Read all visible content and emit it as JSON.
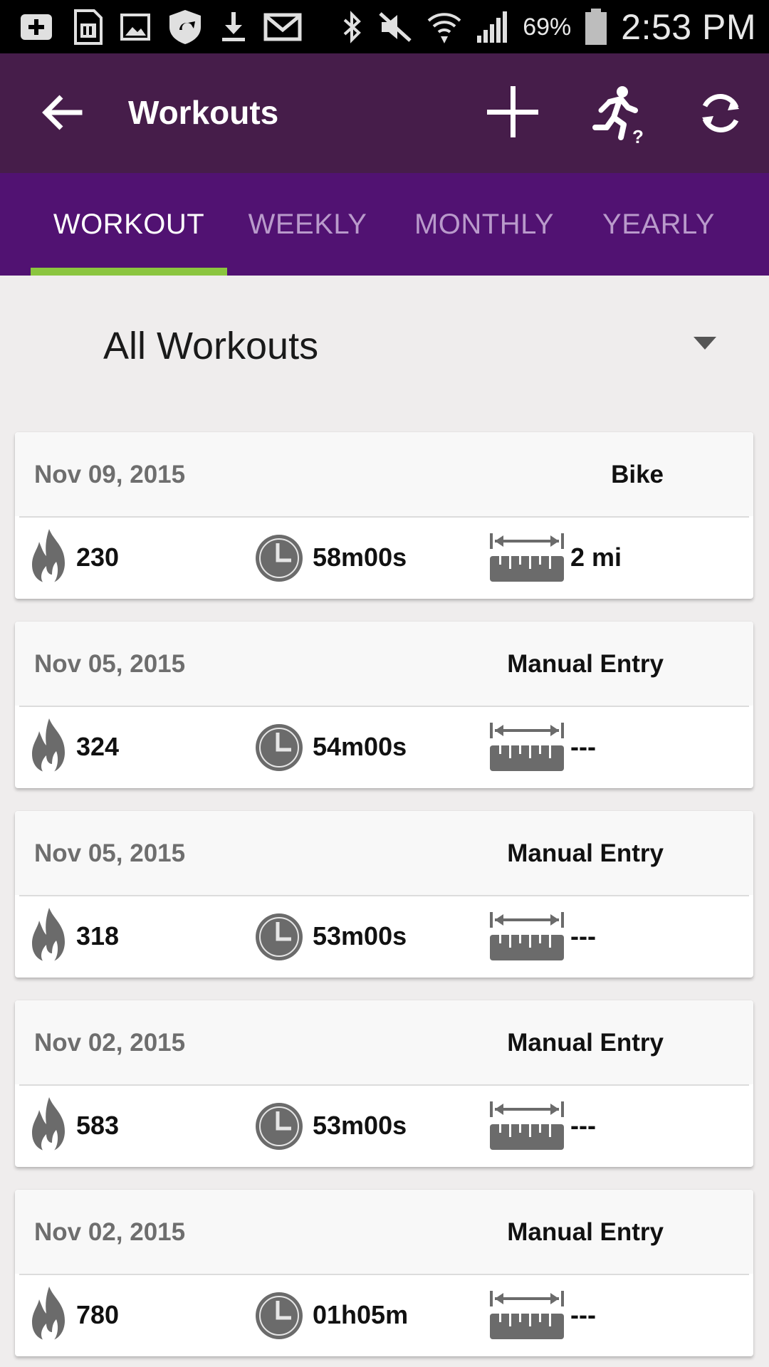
{
  "status_bar": {
    "icons": [
      "add-box-icon",
      "sim-card-icon",
      "image-icon",
      "shield-sync-icon",
      "download-icon",
      "gmail-icon",
      "bluetooth-icon",
      "mute-icon",
      "wifi-icon",
      "signal-icon",
      "battery-icon"
    ],
    "battery": "69%",
    "time": "2:53 PM"
  },
  "app_bar": {
    "title": "Workouts",
    "colors": {
      "app_bar": "#461d4a",
      "tabs": "#511272",
      "indicator": "#8bc53f"
    }
  },
  "tabs": [
    {
      "label": "WORKOUT",
      "active": true
    },
    {
      "label": "WEEKLY",
      "active": false
    },
    {
      "label": "MONTHLY",
      "active": false
    },
    {
      "label": "YEARLY",
      "active": false
    }
  ],
  "filter": {
    "selected": "All Workouts"
  },
  "workouts": [
    {
      "date": "Nov 09, 2015",
      "type": "Bike",
      "calories": "230",
      "duration": "58m00s",
      "distance": "2 mi"
    },
    {
      "date": "Nov 05, 2015",
      "type": "Manual Entry",
      "calories": "324",
      "duration": "54m00s",
      "distance": "---"
    },
    {
      "date": "Nov 05, 2015",
      "type": "Manual Entry",
      "calories": "318",
      "duration": "53m00s",
      "distance": "---"
    },
    {
      "date": "Nov 02, 2015",
      "type": "Manual Entry",
      "calories": "583",
      "duration": "53m00s",
      "distance": "---"
    },
    {
      "date": "Nov 02, 2015",
      "type": "Manual Entry",
      "calories": "780",
      "duration": "01h05m",
      "distance": "---"
    }
  ]
}
